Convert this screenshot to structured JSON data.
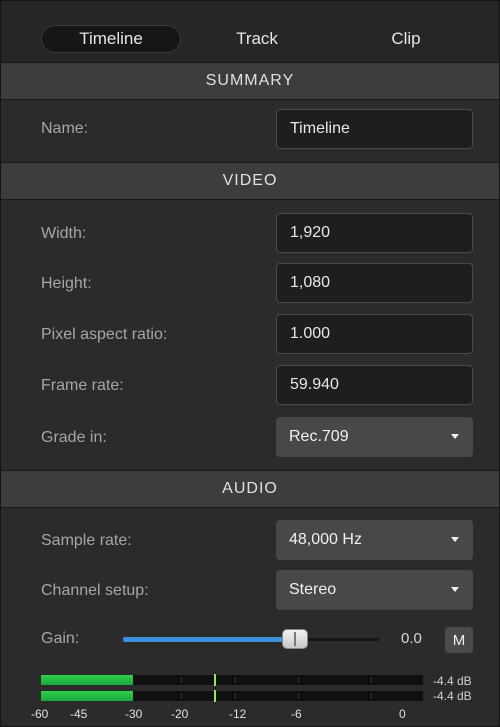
{
  "tabs": [
    {
      "label": "Timeline",
      "active": true
    },
    {
      "label": "Track",
      "active": false
    },
    {
      "label": "Clip",
      "active": false
    }
  ],
  "summary": {
    "header": "SUMMARY",
    "name_label": "Name:",
    "name_value": "Timeline"
  },
  "video": {
    "header": "VIDEO",
    "width_label": "Width:",
    "width_value": "1,920",
    "height_label": "Height:",
    "height_value": "1,080",
    "par_label": "Pixel aspect ratio:",
    "par_value": "1.000",
    "frame_rate_label": "Frame rate:",
    "frame_rate_value": "59.940",
    "grade_label": "Grade in:",
    "grade_value": "Rec.709"
  },
  "audio": {
    "header": "AUDIO",
    "sample_rate_label": "Sample rate:",
    "sample_rate_value": "48,000 Hz",
    "channel_label": "Channel setup:",
    "channel_value": "Stereo",
    "gain_label": "Gain:",
    "gain_value": "0.0",
    "gain_level": 0.67,
    "mute_label": "M"
  },
  "meters": {
    "left_db": "-4.4 dB",
    "right_db": "-4.4 dB",
    "scale": [
      "-60",
      "-45",
      "-30",
      "-20",
      "-12",
      "-6",
      "0"
    ]
  },
  "colors": {
    "accent": "#3c8fd8",
    "meter": "#2fd04e",
    "panel": "#2b2b2b",
    "section": "#3d3d3d"
  }
}
